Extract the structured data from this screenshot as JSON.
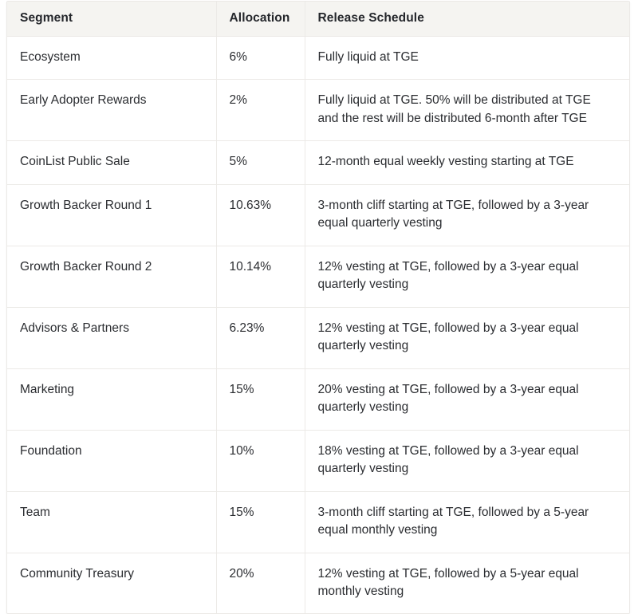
{
  "table": {
    "columns": [
      {
        "key": "segment",
        "label": "Segment"
      },
      {
        "key": "alloc",
        "label": "Allocation"
      },
      {
        "key": "schedule",
        "label": "Release Schedule"
      }
    ],
    "rows": [
      {
        "segment": "Ecosystem",
        "alloc": "6%",
        "schedule": "Fully liquid at TGE"
      },
      {
        "segment": "Early Adopter Rewards",
        "alloc": "2%",
        "schedule": "Fully liquid at TGE. 50% will be distributed at TGE and the rest will be distributed 6-month after TGE"
      },
      {
        "segment": "CoinList Public Sale",
        "alloc": "5%",
        "schedule": "12-month equal weekly vesting starting at TGE"
      },
      {
        "segment": "Growth Backer Round 1",
        "alloc": "10.63%",
        "schedule": "3-month cliff starting at TGE, followed by a 3-year equal quarterly vesting"
      },
      {
        "segment": "Growth Backer Round 2",
        "alloc": "10.14%",
        "schedule": "12% vesting at TGE, followed by a 3-year equal quarterly vesting"
      },
      {
        "segment": "Advisors & Partners",
        "alloc": "6.23%",
        "schedule": "12% vesting at TGE, followed by a 3-year equal quarterly vesting"
      },
      {
        "segment": "Marketing",
        "alloc": "15%",
        "schedule": "20% vesting at TGE, followed by a 3-year equal quarterly vesting"
      },
      {
        "segment": "Foundation",
        "alloc": "10%",
        "schedule": "18% vesting at TGE, followed by a 3-year equal quarterly vesting"
      },
      {
        "segment": "Team",
        "alloc": "15%",
        "schedule": "3-month cliff starting at TGE, followed by a 5-year equal monthly vesting"
      },
      {
        "segment": "Community Treasury",
        "alloc": "20%",
        "schedule": "12% vesting at TGE, followed by a 5-year equal monthly vesting"
      }
    ]
  },
  "colors": {
    "header_background": "#f5f4f1",
    "row_background": "#ffffff",
    "border": "#eceae7",
    "text": "#2b2d31",
    "header_text": "#24262b"
  }
}
